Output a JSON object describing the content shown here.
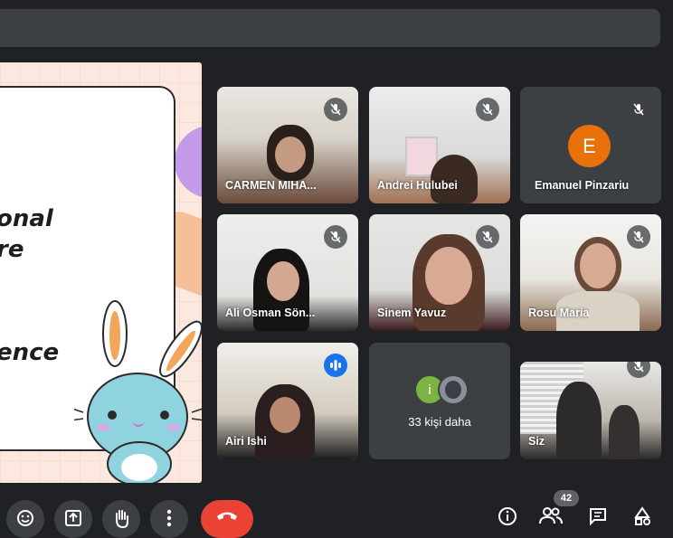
{
  "slide": {
    "text_lines": [
      "onal",
      "re",
      "ence"
    ]
  },
  "participants": [
    {
      "name": "CARMEN MIHA...",
      "muted": true
    },
    {
      "name": "Andrei Hulubei",
      "muted": true
    },
    {
      "name": "Emanuel Pinzariu",
      "muted": true,
      "avatar_letter": "E",
      "avatar_color": "#e8710a"
    },
    {
      "name": "Ali Osman Sön...",
      "muted": true
    },
    {
      "name": "Sinem Yavuz",
      "muted": true
    },
    {
      "name": "Rosu Maria",
      "muted": true
    },
    {
      "name": "Airi Ishi",
      "speaking": true
    },
    {
      "name": "Siz",
      "muted": true
    }
  ],
  "more_tile": {
    "avatar_letter": "i",
    "avatar_color": "#7cb342",
    "label": "33 kişi daha"
  },
  "controls": {
    "participants_count": "42",
    "icons": [
      "emoji-icon",
      "present-icon",
      "raise-hand-icon",
      "more-options-icon",
      "end-call-icon",
      "info-icon",
      "people-icon",
      "chat-icon",
      "activities-icon"
    ]
  },
  "colors": {
    "background": "#202124",
    "tile": "#3c4043",
    "hangup": "#ea4335",
    "active_speaker": "#8ab4f8"
  }
}
